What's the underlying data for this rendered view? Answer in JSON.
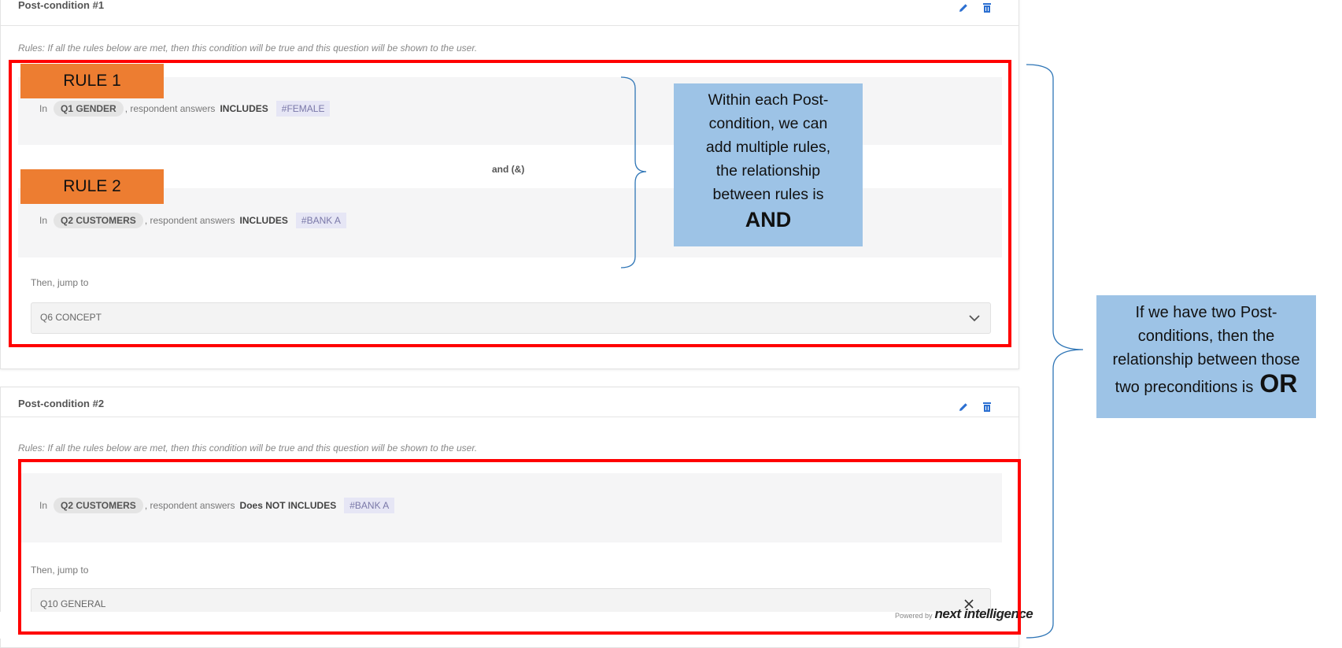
{
  "post_conditions": [
    {
      "title": "Post-condition #1",
      "rules_text": "Rules: If all the rules below are met, then this condition will be true and this question will be shown to the user.",
      "rules": [
        {
          "in_label": "In",
          "question": "Q1 GENDER",
          "respondent_text": ", respondent answers",
          "operator": "INCLUDES",
          "tag": "#FEMALE"
        },
        {
          "in_label": "In",
          "question": "Q2 CUSTOMERS",
          "respondent_text": ", respondent answers",
          "operator": "INCLUDES",
          "tag": "#BANK A"
        }
      ],
      "joiner": "and (&)",
      "then_label": "Then, jump to",
      "jump_target": "Q6 CONCEPT"
    },
    {
      "title": "Post-condition #2",
      "rules_text": "Rules: If all the rules below are met, then this condition will be true and this question will be shown to the user.",
      "rules": [
        {
          "in_label": "In",
          "question": "Q2 CUSTOMERS",
          "respondent_text": ", respondent answers",
          "operator": "Does NOT INCLUDES",
          "tag": "#BANK A"
        }
      ],
      "then_label": "Then, jump to",
      "jump_target": "Q10 GENERAL"
    }
  ],
  "annotations": {
    "rule1_badge": "RULE 1",
    "rule2_badge": "RULE 2",
    "and_callout": {
      "line1": "Within each Post-",
      "line2": "condition, we can",
      "line3": "add multiple rules,",
      "line4": "the relationship",
      "line5": "between rules is",
      "emphasis": "AND"
    },
    "or_callout": {
      "line1": "If we have two Post-",
      "line2": "conditions, then the",
      "line3": "relationship between those",
      "line4": "two preconditions is",
      "emphasis": "OR"
    }
  },
  "footer": {
    "powered_by": "Powered by",
    "brand": "next intelligence"
  },
  "colors": {
    "annotation_red": "#ff0000",
    "badge_orange": "#ed7d31",
    "callout_blue": "#9dc3e6",
    "edit_icon": "#2b6fd1"
  }
}
